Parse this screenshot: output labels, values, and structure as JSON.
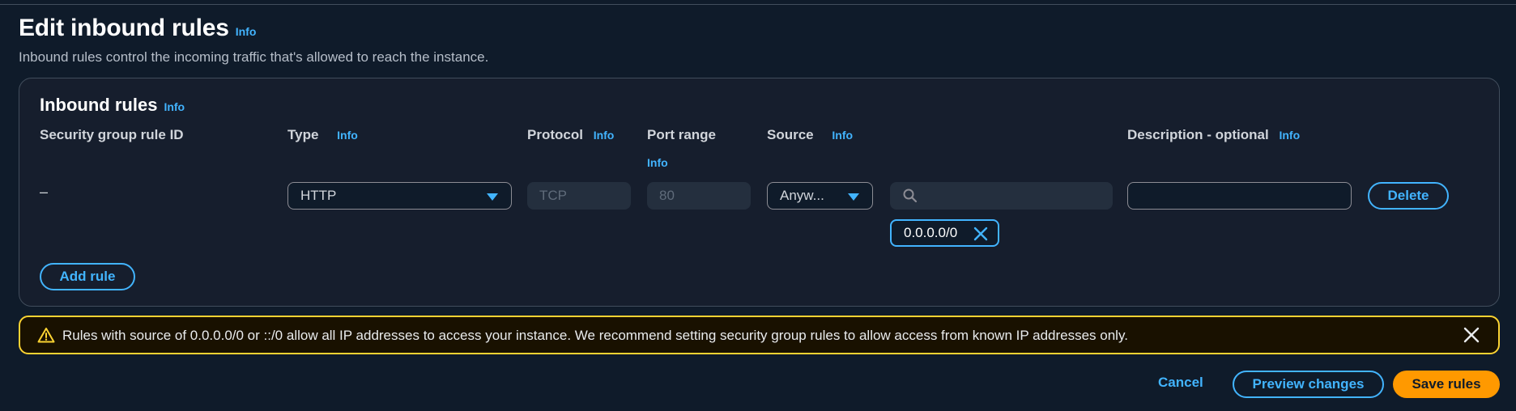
{
  "page": {
    "title": "Edit inbound rules",
    "title_info": "Info",
    "subtitle": "Inbound rules control the incoming traffic that's allowed to reach the instance."
  },
  "panel": {
    "title": "Inbound rules",
    "title_info": "Info",
    "columns": {
      "rule_id": "Security group rule ID",
      "type": "Type",
      "type_info": "Info",
      "protocol": "Protocol",
      "protocol_info": "Info",
      "port_range": "Port range",
      "port_range_info": "Info",
      "source": "Source",
      "source_info": "Info",
      "description": "Description - optional",
      "description_info": "Info"
    },
    "rule": {
      "rule_id": "–",
      "type": "HTTP",
      "protocol": "TCP",
      "port_range": "80",
      "source": "Anyw...",
      "source_search": "",
      "source_token": "0.0.0.0/0",
      "description": "",
      "delete_label": "Delete"
    },
    "add_rule_label": "Add rule"
  },
  "warning": {
    "message": "Rules with source of 0.0.0.0/0 or ::/0 allow all IP addresses to access your instance. We recommend setting security group rules to allow access from known IP addresses only.",
    "color": "#fbd332"
  },
  "footer": {
    "cancel_label": "Cancel",
    "preview_label": "Preview changes",
    "save_label": "Save rules"
  },
  "colors": {
    "accent": "#42b4ff",
    "primary": "#ff9900",
    "background": "#0f1b2a"
  },
  "icons": {
    "search": "search-icon",
    "caret": "caret-down-icon",
    "warning": "warning-icon",
    "close": "close-icon",
    "token_remove": "remove-token-icon"
  }
}
